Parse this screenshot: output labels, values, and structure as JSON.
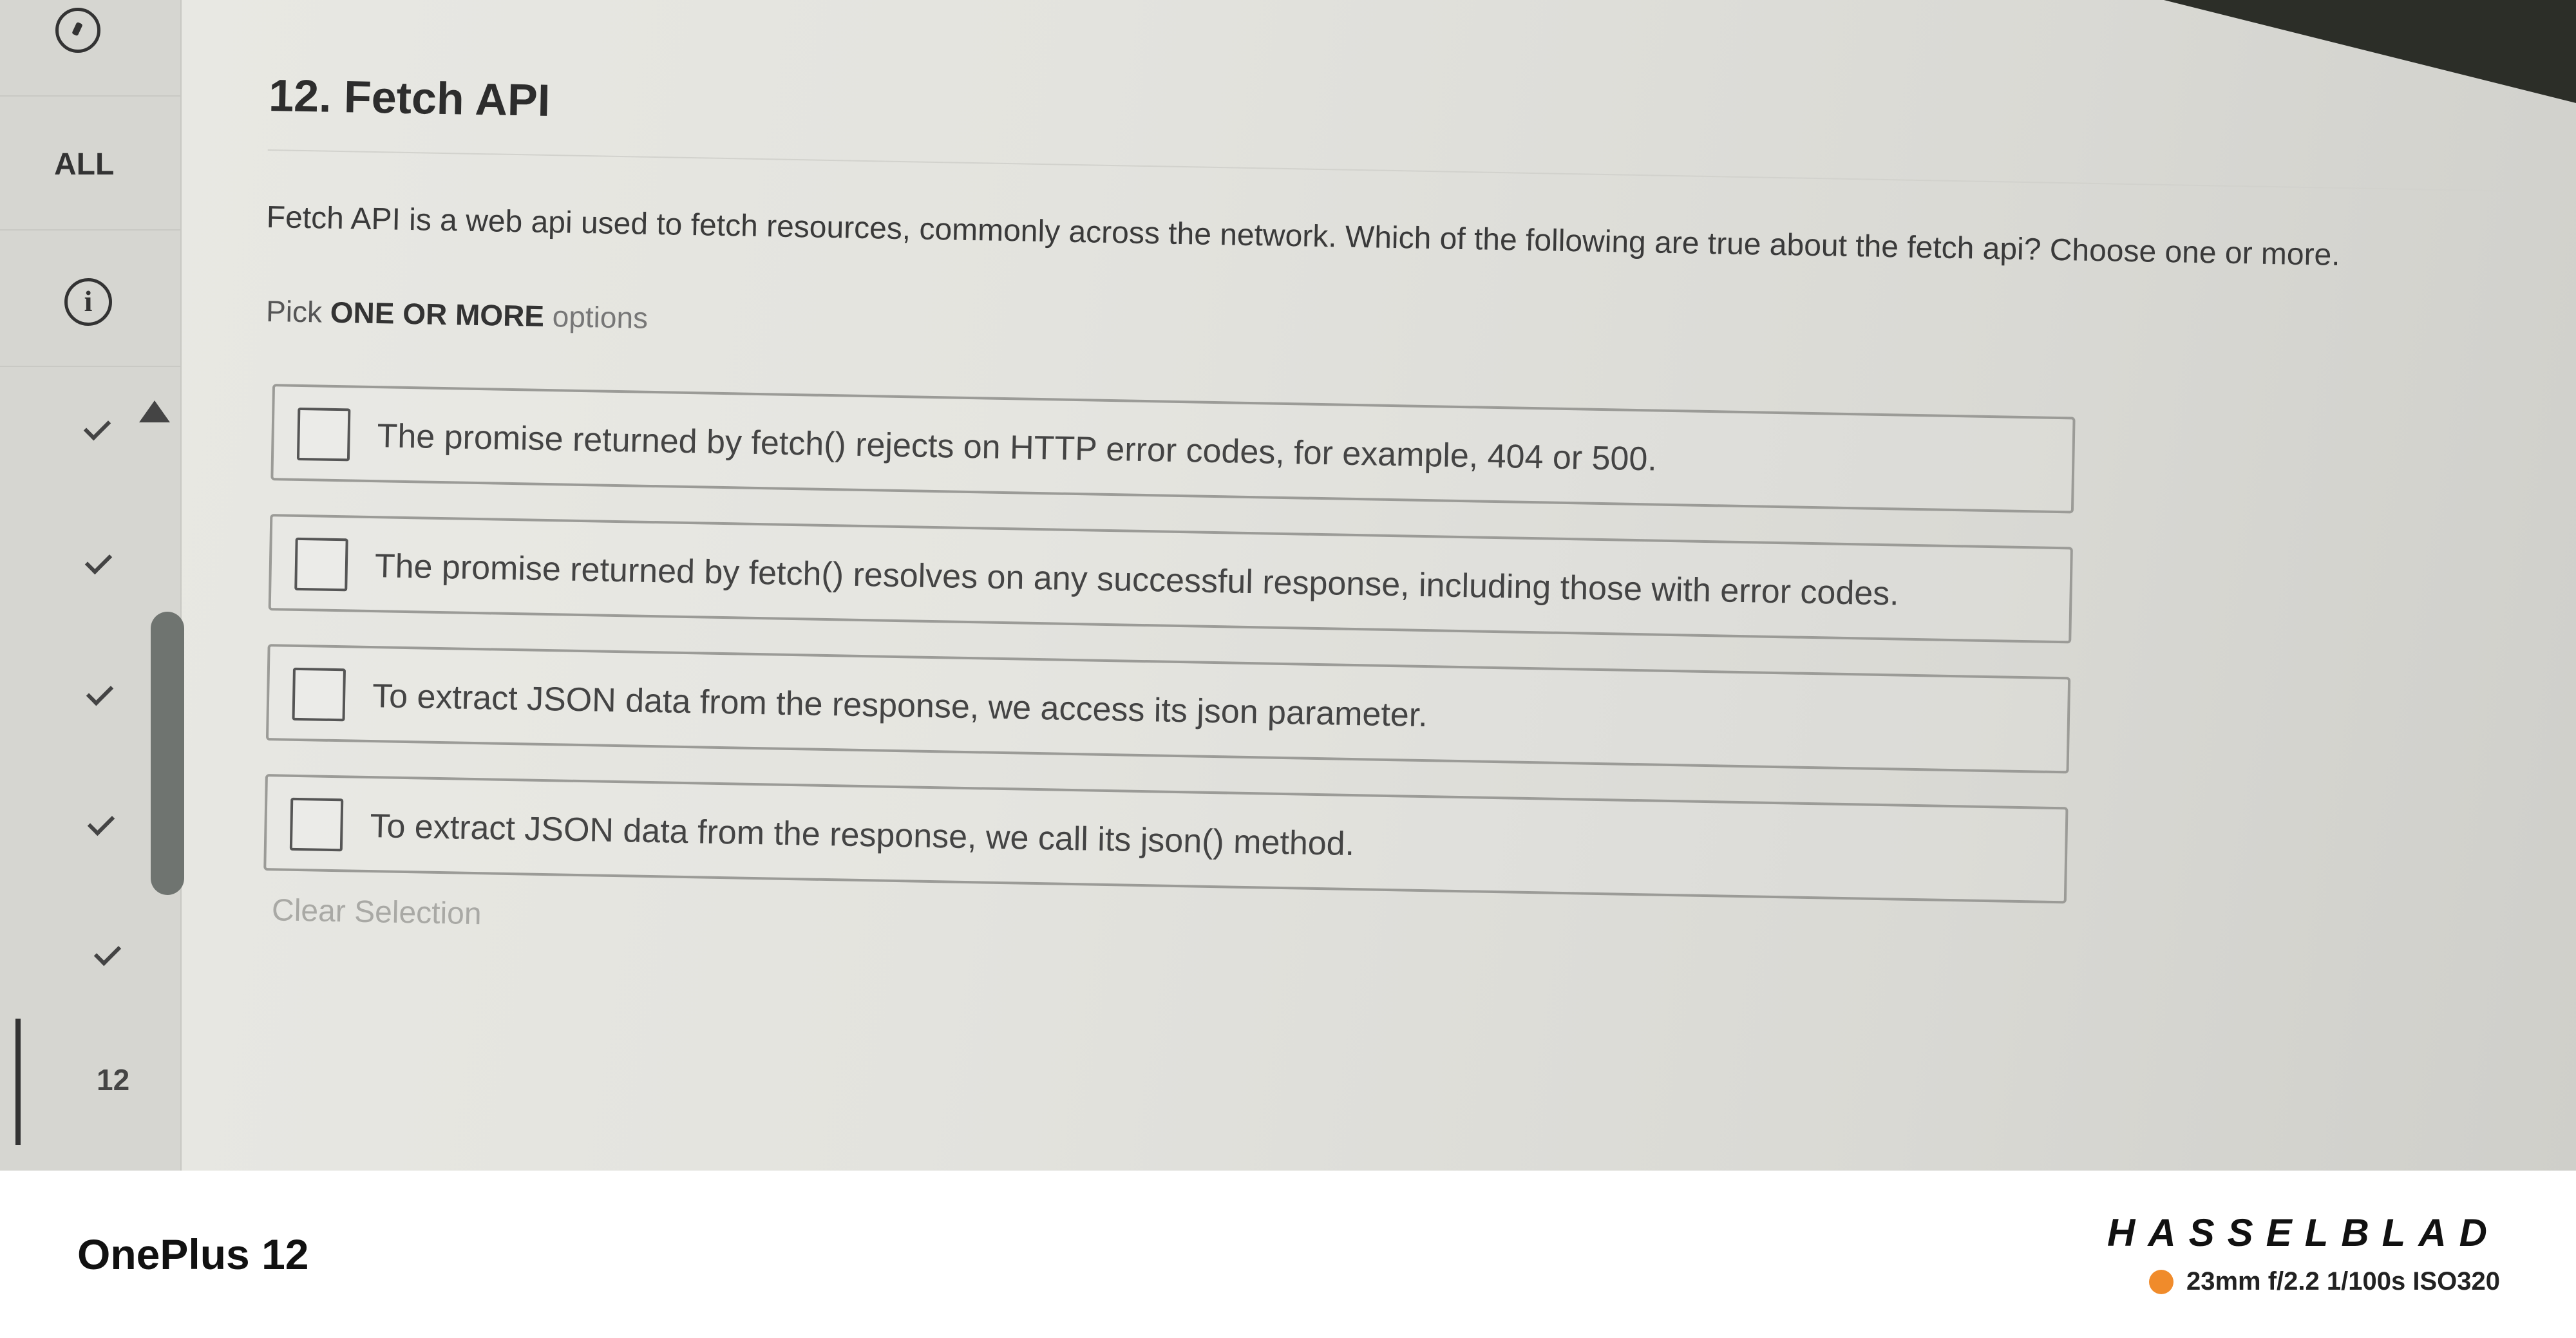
{
  "sidebar": {
    "all_label": "ALL",
    "current_question": "12",
    "timer_icon": "timer-icon",
    "info_icon": "info-icon",
    "answered_icon": "check-icon"
  },
  "question": {
    "title": "12. Fetch API",
    "prompt": "Fetch API is a web api used to fetch resources, commonly across the network. Which of the following are true about the fetch api?  Choose one or more.",
    "pick_prefix": "Pick ",
    "pick_emphasis": "ONE OR MORE",
    "pick_suffix": " options",
    "options": [
      {
        "label": "The promise returned by fetch() rejects on HTTP error codes, for example, 404 or 500.",
        "checked": false
      },
      {
        "label": "The promise returned by fetch() resolves on any successful response, including those with error codes.",
        "checked": false
      },
      {
        "label": "To extract JSON data from the response, we access its json parameter.",
        "checked": false
      },
      {
        "label": "To extract JSON data from the response, we call its json() method.",
        "checked": false
      }
    ],
    "clear_label": "Clear Selection"
  },
  "footer": {
    "device": "OnePlus 12",
    "brand": "HASSELBLAD",
    "specs": "23mm  f/2.2  1/100s  ISO320"
  },
  "colors": {
    "spec_dot": "#f08b2b"
  }
}
